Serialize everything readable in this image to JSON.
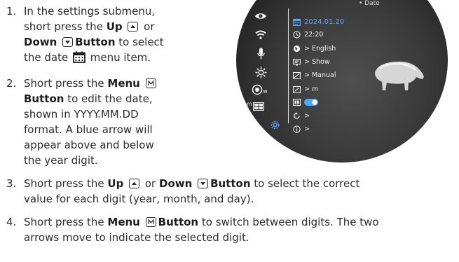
{
  "steps": [
    {
      "number": "1.",
      "line1": "In the settings submenu,",
      "line2_a": "short press the ",
      "line2_b": "Up",
      "line2_c": " or",
      "line3_a": "Down",
      "line3_b": "Button",
      "line3_c": " to select",
      "line4_a": "the date",
      "line4_b": " menu item."
    },
    {
      "number": "2.",
      "line1_a": "Short press the ",
      "line1_b": "Menu",
      "line2_a": "Button",
      "line2_b": " to edit the date,",
      "line3": "shown in YYYY.MM.DD",
      "line4": "format. A blue arrow will",
      "line5": "appear above and below",
      "line6": "the year digit."
    },
    {
      "number": "3.",
      "line1_a": "Short press the ",
      "line1_b": "Up",
      "line1_c": " or ",
      "line1_d": "Down",
      "line1_e": "Button",
      "line1_f": " to select the correct",
      "line2": "value for each digit (year, month, and day)."
    },
    {
      "number": "4.",
      "line1_a": "Short press the ",
      "line1_b": "Menu",
      "line1_c": "Button",
      "line1_d": " to switch between digits. The two",
      "line2": "arrows move to indicate the selected digit."
    }
  ],
  "scope": {
    "top_label": "• Date",
    "date_value": "2024.01.20",
    "time_value": "22:20",
    "language_value": "> English",
    "display_value": "> Show",
    "mode_value": "> Manual",
    "units_value": "> m",
    "reset_value": ">",
    "info_value": ">",
    "left_icon_w_label": "w",
    "left_icon_m_label": "m",
    "colors": {
      "date_highlight": "#5aa9ff",
      "toggle_on": "#4aa8ff"
    }
  }
}
